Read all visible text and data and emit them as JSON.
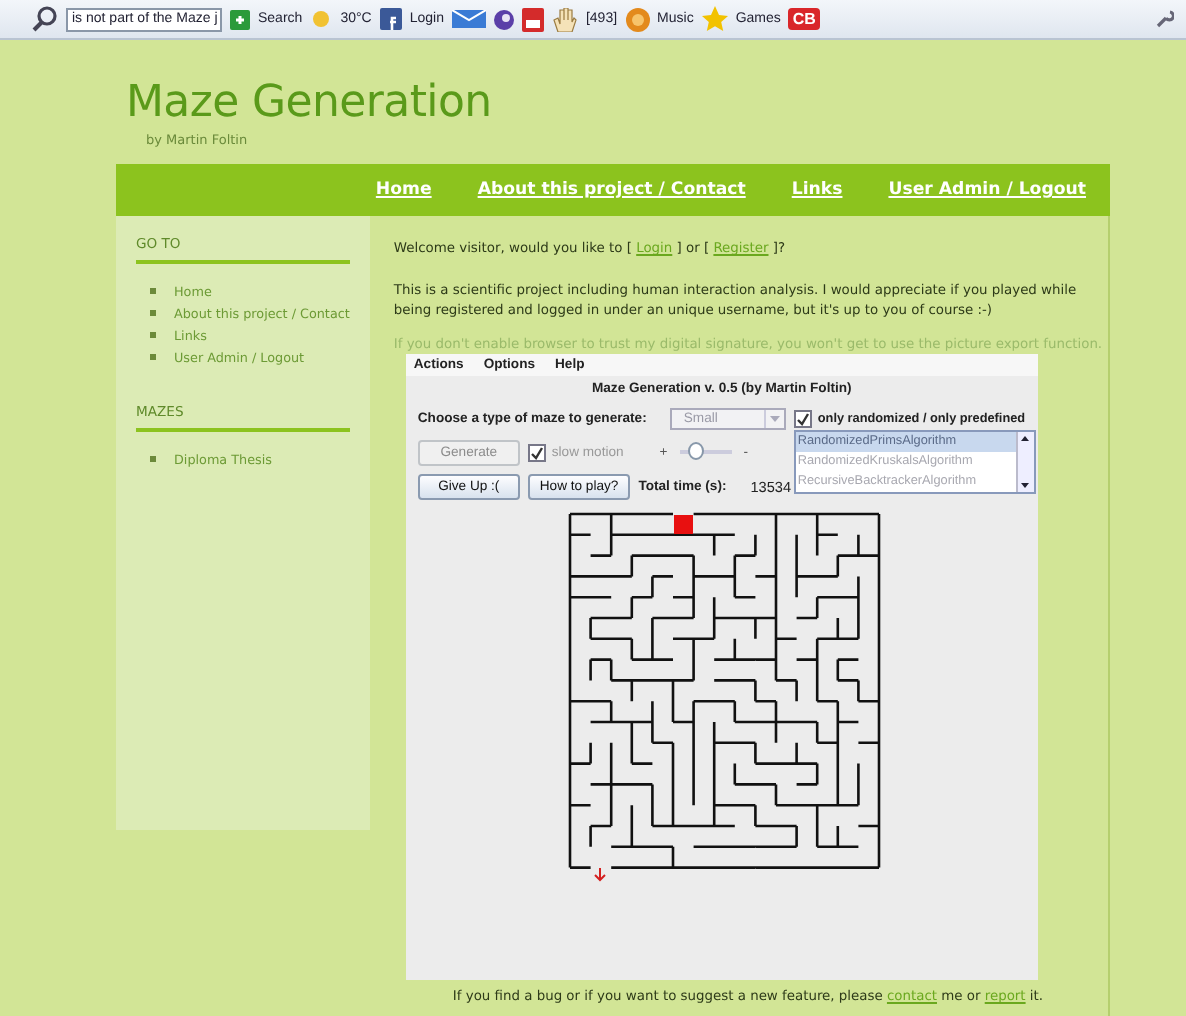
{
  "toolbar": {
    "search_value": "is not part of the Maze j",
    "items": [
      {
        "kind": "search",
        "label": "Search"
      },
      {
        "kind": "weather",
        "label": "30°C"
      },
      {
        "kind": "social",
        "label": "Login"
      },
      {
        "kind": "mail"
      },
      {
        "kind": "swirl"
      },
      {
        "kind": "video"
      },
      {
        "kind": "hand",
        "label": "[493]"
      },
      {
        "kind": "music",
        "label": "Music"
      },
      {
        "kind": "star",
        "label": "Games"
      },
      {
        "kind": "badge",
        "label": "CB"
      }
    ]
  },
  "header": {
    "title": "Maze Generation",
    "subtitle": "by Martin Foltin"
  },
  "nav": [
    "Home",
    "About this project / Contact",
    "Links",
    "User Admin / Logout"
  ],
  "sidebar": [
    {
      "heading": "GO TO",
      "items": [
        "Home",
        "About this project / Contact",
        "Links",
        "User Admin / Logout"
      ]
    },
    {
      "heading": "MAZES",
      "items": [
        "Diploma Thesis"
      ]
    }
  ],
  "content": {
    "welcome": [
      {
        "kind": "text",
        "text": "Welcome visitor, would you like to [ "
      },
      {
        "kind": "link",
        "text": "Login"
      },
      {
        "kind": "text",
        "text": " ] or [ "
      },
      {
        "kind": "link",
        "text": "Register"
      },
      {
        "kind": "text",
        "text": " ]?"
      }
    ],
    "intro": "This is a scientific project including human interaction analysis. I would appreciate if you played while being registered and logged in under an unique username, but it's up to you of course :-)",
    "notice": "If you don't enable browser to trust my digital signature, you won't get to use the picture export function.",
    "footer": [
      {
        "kind": "text",
        "text": "If you find a bug or if you want to suggest a new feature, please "
      },
      {
        "kind": "link",
        "text": "contact"
      },
      {
        "kind": "text",
        "text": " me or "
      },
      {
        "kind": "link",
        "text": "report"
      },
      {
        "kind": "text",
        "text": " it."
      }
    ]
  },
  "applet": {
    "menus": [
      "Actions",
      "Options",
      "Help"
    ],
    "title": "Maze Generation v. 0.5 (by Martin Foltin)",
    "type_label": "Choose a type of maze to generate:",
    "size_select": {
      "value": "Small",
      "disabled": true
    },
    "only_randomized": {
      "label": "only randomized / only predefined",
      "checked": true
    },
    "generate": {
      "label": "Generate",
      "disabled": true
    },
    "slow_motion": {
      "label": "slow motion",
      "checked": true,
      "disabled": true
    },
    "speed": {
      "left": "+",
      "right": "-",
      "level": 0.3
    },
    "algorithms": [
      {
        "label": "RandomizedPrimsAlgorithm",
        "selected": true
      },
      {
        "label": "RandomizedKruskalsAlgorithm",
        "selected": false
      },
      {
        "label": "RecursiveBacktrackerAlgorithm",
        "selected": false
      }
    ],
    "give_up": "Give Up :(",
    "how_to_play": "How to play?",
    "total_label": "Total time (s):",
    "total_value": "13534"
  }
}
